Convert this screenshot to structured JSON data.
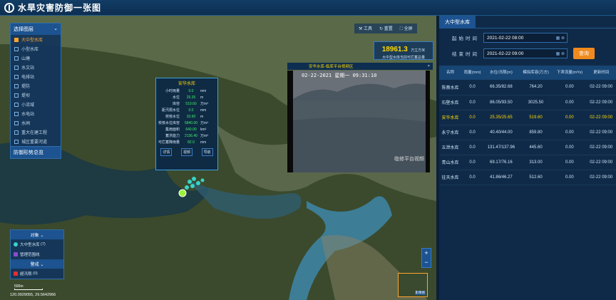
{
  "header": {
    "title": "水旱灾害防御一张图"
  },
  "layers": {
    "title": "选择图层",
    "items": [
      "大中型水库",
      "小型水库",
      "山塘",
      "水文站",
      "电排站",
      "堤防",
      "堤坝",
      "小流域",
      "水电站",
      "水闸",
      "重大在建工程",
      "城区重要河道"
    ],
    "active": 0,
    "footer": "防御形势总览"
  },
  "tools": {
    "tool": "工具",
    "reset": "重置",
    "full": "全屏"
  },
  "stat": {
    "value": "18961.3",
    "unit": "万立方米",
    "label": "大中型水库当前可拦蓄总量"
  },
  "popup": {
    "title": "安华水库",
    "rows": [
      {
        "k": "小时雨量",
        "v": "0.0",
        "u": "mm"
      },
      {
        "k": "水位",
        "v": "25.35",
        "u": "m"
      },
      {
        "k": "库容",
        "v": "519.60",
        "u": "万m³"
      },
      {
        "k": "距汛限水位",
        "v": "0.0",
        "u": "mm"
      },
      {
        "k": "校核水位",
        "v": "33.90",
        "u": "m"
      },
      {
        "k": "校核水位库容",
        "v": "5840.00",
        "u": "万m³"
      },
      {
        "k": "集雨面积",
        "v": "640.00",
        "u": "km²"
      },
      {
        "k": "蓄洪能力",
        "v": "2136.40",
        "u": "万m³"
      },
      {
        "k": "可拦蓄降雨量",
        "v": "82.0",
        "u": "mm"
      }
    ],
    "btns": [
      "详情",
      "视频",
      "导航"
    ]
  },
  "video": {
    "title": "安华水库-临库平台视频区",
    "timestamp": "02-22-2021 星期一 09:31:10",
    "watermark": "临修平台视频"
  },
  "legend": {
    "obj_title": "对象",
    "obj_items": [
      {
        "label": "大中型水库",
        "count": "(7)",
        "color": "#38d4c8"
      },
      {
        "label": "管理范围线",
        "count": "",
        "color": "#8a4bd0"
      }
    ],
    "warn_title": "警戒",
    "warn_items": [
      {
        "label": "超汛限",
        "count": "(0)",
        "color": "#e03030"
      }
    ]
  },
  "map": {
    "scale": "500m",
    "coord": "120.0929055, 29.5642966",
    "minimap": "影像图"
  },
  "right": {
    "tab": "大中型水库",
    "start_label": "起始时间",
    "start": "2021-02-22 08:00",
    "end_label": "结束时间",
    "end": "2021-02-22 09:00",
    "query": "查询",
    "columns": [
      "名称",
      "雨量(mm)",
      "水位/汛限(m)",
      "模拟库容(万方)",
      "下泄流量(m³/s)",
      "更新时间"
    ],
    "rows": [
      [
        "陈蔡水库",
        "0.0",
        "66.35/82.68",
        "764.20",
        "0.00",
        "02-22 09:00"
      ],
      [
        "石壁水库",
        "0.0",
        "86.05/93.50",
        "3025.50",
        "0.00",
        "02-22 09:00"
      ],
      [
        "安华水库",
        "0.0",
        "25.35/25.65",
        "519.60",
        "0.00",
        "02-22 09:00"
      ],
      [
        "永宁水库",
        "0.0",
        "40.40/44.00",
        "859.80",
        "0.00",
        "02-22 09:00"
      ],
      [
        "五泄水库",
        "0.0",
        "131.47/137.96",
        "445.60",
        "0.00",
        "02-22 09:00"
      ],
      [
        "青山水库",
        "0.0",
        "69.17/76.16",
        "313.00",
        "0.00",
        "02-22 09:00"
      ],
      [
        "征天水库",
        "0.0",
        "41.86/46.27",
        "512.60",
        "0.00",
        "02-22 09:00"
      ]
    ],
    "selected": 2
  }
}
